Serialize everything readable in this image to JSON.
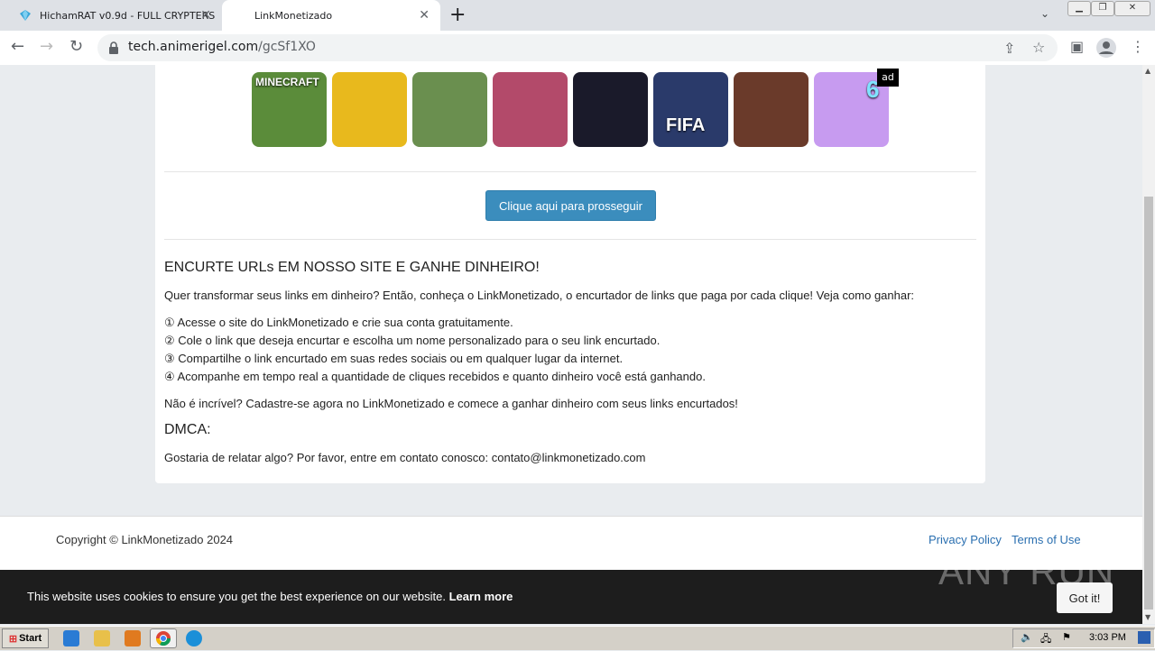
{
  "browser": {
    "tabs": [
      {
        "title": "HichamRAT v0.9d - FULL CRYPTERS"
      },
      {
        "title": "LinkMonetizado"
      }
    ],
    "url_host": "tech.animerigel.com",
    "url_path": "/gcSf1XO"
  },
  "games": {
    "ad_label": "ad",
    "items": [
      {
        "name": "minecraft-thumb",
        "label": "MINECRAFT",
        "color": "#5b8c3a"
      },
      {
        "name": "car-racing-thumb",
        "label": "",
        "color": "#e8b91d"
      },
      {
        "name": "roblox-thumb",
        "label": "",
        "color": "#6a8f4f"
      },
      {
        "name": "scary-teacher-thumb",
        "label": "",
        "color": "#b34a6a"
      },
      {
        "name": "among-us-thumb",
        "label": "",
        "color": "#1a1a2a"
      },
      {
        "name": "fifa-thumb",
        "label": "FIFA",
        "color": "#2a3a6a"
      },
      {
        "name": "fnaf-thumb",
        "label": "",
        "color": "#6a3a2a"
      },
      {
        "name": "piano-tiles-thumb",
        "label": "6",
        "color": "#c79bf0"
      }
    ]
  },
  "main": {
    "proceed_label": "Clique aqui para prosseguir",
    "heading": "ENCURTE URLs EM NOSSO SITE E GANHE DINHEIRO!",
    "intro": "Quer transformar seus links em dinheiro? Então, conheça o LinkMonetizado, o encurtador de links que paga por cada clique! Veja como ganhar:",
    "steps": [
      "① Acesse o site do LinkMonetizado e crie sua conta gratuitamente.",
      "② Cole o link que deseja encurtar e escolha um nome personalizado para o seu link encurtado.",
      "③ Compartilhe o link encurtado em suas redes sociais ou em qualquer lugar da internet.",
      "④ Acompanhe em tempo real a quantidade de cliques recebidos e quanto dinheiro você está ganhando."
    ],
    "closing": "Não é incrível? Cadastre-se agora no LinkMonetizado e comece a ganhar dinheiro com seus links encurtados!",
    "dmca_heading": "DMCA:",
    "dmca_text": "Gostaria de relatar algo? Por favor, entre em contato conosco: contato@linkmonetizado.com"
  },
  "footer": {
    "copyright": "Copyright © LinkMonetizado 2024",
    "privacy": "Privacy Policy",
    "terms": "Terms of Use"
  },
  "cookie": {
    "text": "This website uses cookies to ensure you get the best experience on our website.",
    "learn_more": "Learn more",
    "button": "Got it!"
  },
  "watermark": "ANY RUN",
  "taskbar": {
    "start": "Start",
    "clock": "3:03 PM"
  }
}
